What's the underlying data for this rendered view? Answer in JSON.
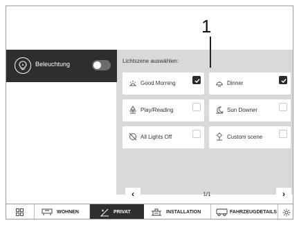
{
  "callout": {
    "number": "1"
  },
  "lighting": {
    "label": "Beleuchtung",
    "toggle_on": false
  },
  "scenes": {
    "heading": "Lichtszene auswählen:",
    "items": [
      {
        "label": "Good Morning",
        "icon": "sunrise-icon",
        "checked": true
      },
      {
        "label": "Dinner",
        "icon": "dinner-icon",
        "checked": true
      },
      {
        "label": "Play/Reading",
        "icon": "lamp-icon",
        "checked": false
      },
      {
        "label": "Sun Downer",
        "icon": "sunset-icon",
        "checked": false
      },
      {
        "label": "All Lights Off",
        "icon": "light-off-icon",
        "checked": false
      },
      {
        "label": "Custom scene",
        "icon": "custom-scene-icon",
        "checked": false
      }
    ]
  },
  "pager": {
    "prev": "‹",
    "next": "›",
    "info": "1/1"
  },
  "nav": {
    "items": [
      {
        "label": "",
        "icon": "grid-icon"
      },
      {
        "label": "WOHNEN",
        "icon": "living-icon"
      },
      {
        "label": "PRIVAT",
        "icon": "privat-icon",
        "active": true
      },
      {
        "label": "INSTALLATION",
        "icon": "installation-icon"
      },
      {
        "label": "FAHRZEUGDETAILS",
        "icon": "vehicle-icon"
      },
      {
        "label": "",
        "icon": "settings-icon"
      }
    ]
  }
}
